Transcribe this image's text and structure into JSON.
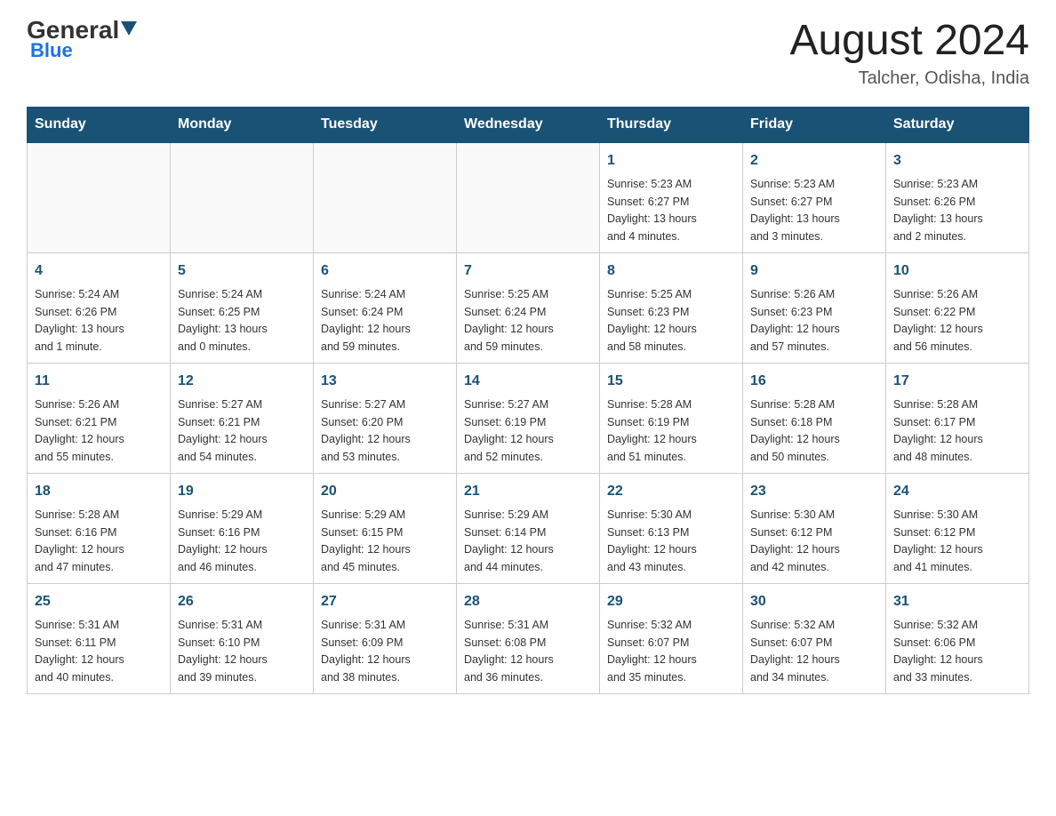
{
  "header": {
    "logo_general": "General",
    "logo_blue": "Blue",
    "month_year": "August 2024",
    "location": "Talcher, Odisha, India"
  },
  "days_of_week": [
    "Sunday",
    "Monday",
    "Tuesday",
    "Wednesday",
    "Thursday",
    "Friday",
    "Saturday"
  ],
  "weeks": [
    [
      {
        "day": "",
        "info": ""
      },
      {
        "day": "",
        "info": ""
      },
      {
        "day": "",
        "info": ""
      },
      {
        "day": "",
        "info": ""
      },
      {
        "day": "1",
        "info": "Sunrise: 5:23 AM\nSunset: 6:27 PM\nDaylight: 13 hours\nand 4 minutes."
      },
      {
        "day": "2",
        "info": "Sunrise: 5:23 AM\nSunset: 6:27 PM\nDaylight: 13 hours\nand 3 minutes."
      },
      {
        "day": "3",
        "info": "Sunrise: 5:23 AM\nSunset: 6:26 PM\nDaylight: 13 hours\nand 2 minutes."
      }
    ],
    [
      {
        "day": "4",
        "info": "Sunrise: 5:24 AM\nSunset: 6:26 PM\nDaylight: 13 hours\nand 1 minute."
      },
      {
        "day": "5",
        "info": "Sunrise: 5:24 AM\nSunset: 6:25 PM\nDaylight: 13 hours\nand 0 minutes."
      },
      {
        "day": "6",
        "info": "Sunrise: 5:24 AM\nSunset: 6:24 PM\nDaylight: 12 hours\nand 59 minutes."
      },
      {
        "day": "7",
        "info": "Sunrise: 5:25 AM\nSunset: 6:24 PM\nDaylight: 12 hours\nand 59 minutes."
      },
      {
        "day": "8",
        "info": "Sunrise: 5:25 AM\nSunset: 6:23 PM\nDaylight: 12 hours\nand 58 minutes."
      },
      {
        "day": "9",
        "info": "Sunrise: 5:26 AM\nSunset: 6:23 PM\nDaylight: 12 hours\nand 57 minutes."
      },
      {
        "day": "10",
        "info": "Sunrise: 5:26 AM\nSunset: 6:22 PM\nDaylight: 12 hours\nand 56 minutes."
      }
    ],
    [
      {
        "day": "11",
        "info": "Sunrise: 5:26 AM\nSunset: 6:21 PM\nDaylight: 12 hours\nand 55 minutes."
      },
      {
        "day": "12",
        "info": "Sunrise: 5:27 AM\nSunset: 6:21 PM\nDaylight: 12 hours\nand 54 minutes."
      },
      {
        "day": "13",
        "info": "Sunrise: 5:27 AM\nSunset: 6:20 PM\nDaylight: 12 hours\nand 53 minutes."
      },
      {
        "day": "14",
        "info": "Sunrise: 5:27 AM\nSunset: 6:19 PM\nDaylight: 12 hours\nand 52 minutes."
      },
      {
        "day": "15",
        "info": "Sunrise: 5:28 AM\nSunset: 6:19 PM\nDaylight: 12 hours\nand 51 minutes."
      },
      {
        "day": "16",
        "info": "Sunrise: 5:28 AM\nSunset: 6:18 PM\nDaylight: 12 hours\nand 50 minutes."
      },
      {
        "day": "17",
        "info": "Sunrise: 5:28 AM\nSunset: 6:17 PM\nDaylight: 12 hours\nand 48 minutes."
      }
    ],
    [
      {
        "day": "18",
        "info": "Sunrise: 5:28 AM\nSunset: 6:16 PM\nDaylight: 12 hours\nand 47 minutes."
      },
      {
        "day": "19",
        "info": "Sunrise: 5:29 AM\nSunset: 6:16 PM\nDaylight: 12 hours\nand 46 minutes."
      },
      {
        "day": "20",
        "info": "Sunrise: 5:29 AM\nSunset: 6:15 PM\nDaylight: 12 hours\nand 45 minutes."
      },
      {
        "day": "21",
        "info": "Sunrise: 5:29 AM\nSunset: 6:14 PM\nDaylight: 12 hours\nand 44 minutes."
      },
      {
        "day": "22",
        "info": "Sunrise: 5:30 AM\nSunset: 6:13 PM\nDaylight: 12 hours\nand 43 minutes."
      },
      {
        "day": "23",
        "info": "Sunrise: 5:30 AM\nSunset: 6:12 PM\nDaylight: 12 hours\nand 42 minutes."
      },
      {
        "day": "24",
        "info": "Sunrise: 5:30 AM\nSunset: 6:12 PM\nDaylight: 12 hours\nand 41 minutes."
      }
    ],
    [
      {
        "day": "25",
        "info": "Sunrise: 5:31 AM\nSunset: 6:11 PM\nDaylight: 12 hours\nand 40 minutes."
      },
      {
        "day": "26",
        "info": "Sunrise: 5:31 AM\nSunset: 6:10 PM\nDaylight: 12 hours\nand 39 minutes."
      },
      {
        "day": "27",
        "info": "Sunrise: 5:31 AM\nSunset: 6:09 PM\nDaylight: 12 hours\nand 38 minutes."
      },
      {
        "day": "28",
        "info": "Sunrise: 5:31 AM\nSunset: 6:08 PM\nDaylight: 12 hours\nand 36 minutes."
      },
      {
        "day": "29",
        "info": "Sunrise: 5:32 AM\nSunset: 6:07 PM\nDaylight: 12 hours\nand 35 minutes."
      },
      {
        "day": "30",
        "info": "Sunrise: 5:32 AM\nSunset: 6:07 PM\nDaylight: 12 hours\nand 34 minutes."
      },
      {
        "day": "31",
        "info": "Sunrise: 5:32 AM\nSunset: 6:06 PM\nDaylight: 12 hours\nand 33 minutes."
      }
    ]
  ]
}
